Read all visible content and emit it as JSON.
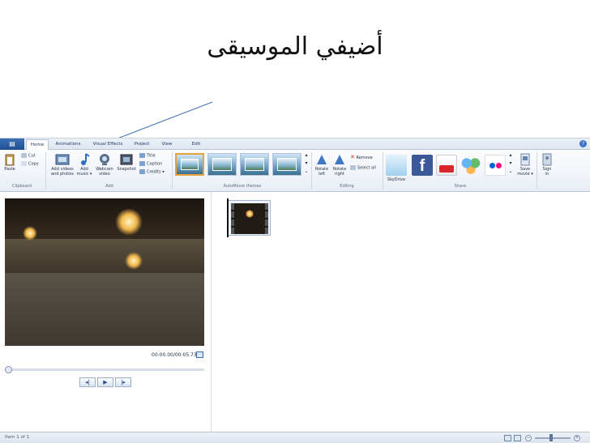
{
  "slide": {
    "title": "أضيفي الموسيقى"
  },
  "app": {
    "menu_button": "▤",
    "tabs": [
      {
        "label": "Home",
        "active": true
      },
      {
        "label": "Animations"
      },
      {
        "label": "Visual Effects"
      },
      {
        "label": "Project"
      },
      {
        "label": "View"
      },
      {
        "label": "Edit"
      }
    ],
    "help_icon": "?"
  },
  "ribbon": {
    "clipboard": {
      "paste": "Paste",
      "cut": "Cut",
      "copy": "Copy",
      "group_label": "Clipboard"
    },
    "add": {
      "add_videos_line1": "Add videos",
      "add_videos_line2": "and photos",
      "add_music_line1": "Add",
      "add_music_line2": "music ▾",
      "webcam_line1": "Webcam",
      "webcam_line2": "video",
      "snapshot": "Snapshot",
      "title": "Title",
      "caption": "Caption",
      "credits": "Credits ▾",
      "group_label": "Add"
    },
    "themes": {
      "group_label": "AutoMovie themes"
    },
    "editing": {
      "rotate_left_line1": "Rotate",
      "rotate_left_line2": "left",
      "rotate_right_line1": "Rotate",
      "rotate_right_line2": "right",
      "remove": "Remove",
      "select_all": "Select all",
      "group_label": "Editing"
    },
    "share": {
      "skydrive": "SkyDrive",
      "save_movie_line1": "Save",
      "save_movie_line2": "movie ▾",
      "sign_in_line1": "Sign",
      "sign_in_line2": "in",
      "group_label": "Share"
    }
  },
  "player": {
    "time": "00:00.00/00:05.73",
    "prev": "◂|",
    "play": "▶",
    "next": "|▸"
  },
  "status": {
    "text": "Item 1 of 1",
    "zoom_minus": "−",
    "zoom_plus": "+",
    "zoom_level": 0.45
  },
  "colors": {
    "ribbon_accent": "#1e4f94",
    "selected_theme_border": "#e8a33c"
  }
}
